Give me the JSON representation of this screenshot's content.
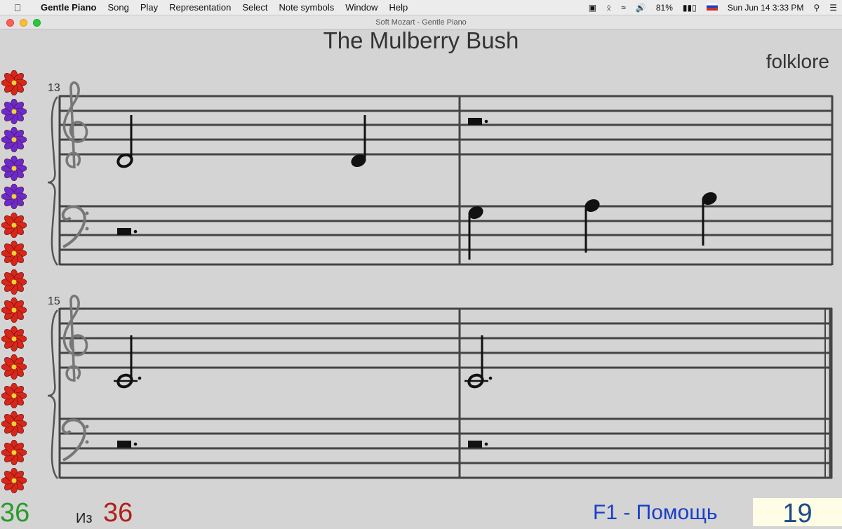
{
  "menubar": {
    "app_name": "Gentle Piano",
    "items": [
      "Song",
      "Play",
      "Representation",
      "Select",
      "Note symbols",
      "Window",
      "Help"
    ],
    "battery": "81%",
    "clock": "Sun Jun 14  3:33 PM"
  },
  "window": {
    "title": "Soft Mozart - Gentle Piano"
  },
  "song": {
    "title": "The Mulberry Bush",
    "author": "folklore"
  },
  "systems": [
    {
      "measure_number": "13"
    },
    {
      "measure_number": "15"
    }
  ],
  "flowers": [
    "red",
    "purple",
    "purple",
    "purple",
    "purple",
    "red",
    "red",
    "red",
    "red",
    "red",
    "red",
    "red",
    "red",
    "red",
    "red"
  ],
  "colors": {
    "red_flower": "#d8261a",
    "purple_flower": "#6a2ad0"
  },
  "status": {
    "current": "36",
    "of_label": "Из",
    "total": "36",
    "help": "F1 - Помощь",
    "page": "19"
  }
}
